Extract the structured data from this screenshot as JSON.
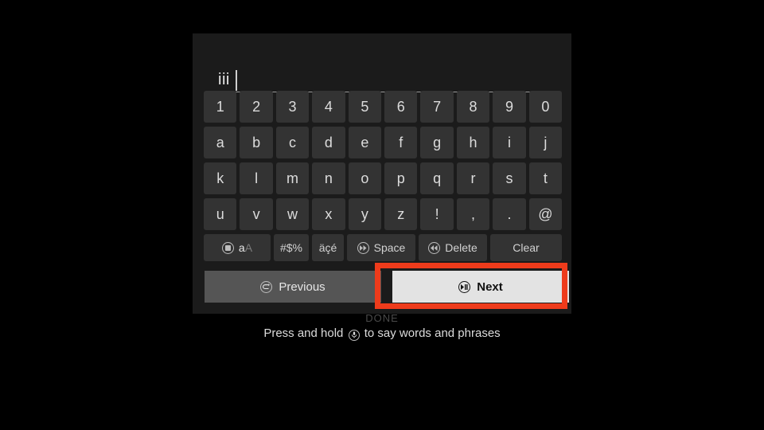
{
  "screen": {
    "background_color": "#000000",
    "panel_color": "#1b1b1b",
    "highlight_color": "#ee3b1b"
  },
  "input": {
    "value": "iii",
    "placeholder": ""
  },
  "keyboard": {
    "rows": [
      {
        "name": "numbers",
        "keys": [
          "1",
          "2",
          "3",
          "4",
          "5",
          "6",
          "7",
          "8",
          "9",
          "0"
        ]
      },
      {
        "name": "letters-1",
        "keys": [
          "a",
          "b",
          "c",
          "d",
          "e",
          "f",
          "g",
          "h",
          "i",
          "j"
        ]
      },
      {
        "name": "letters-2",
        "keys": [
          "k",
          "l",
          "m",
          "n",
          "o",
          "p",
          "q",
          "r",
          "s",
          "t"
        ]
      },
      {
        "name": "letters-3",
        "keys": [
          "u",
          "v",
          "w",
          "x",
          "y",
          "z",
          "!",
          ",",
          ".",
          "@"
        ]
      }
    ],
    "function_row": {
      "case_toggle": {
        "icon": "circle-square-icon",
        "lower": "a",
        "upper": "A"
      },
      "symbols": "#$%",
      "accents": "äçé",
      "space": {
        "icon": "circle-ff-icon",
        "label": "Space"
      },
      "delete": {
        "icon": "circle-rw-icon",
        "label": "Delete"
      },
      "clear": "Clear"
    }
  },
  "nav": {
    "previous": {
      "icon": "circle-back-icon",
      "label": "Previous",
      "focused": false
    },
    "next": {
      "icon": "circle-playpause-icon",
      "label": "Next",
      "focused": true
    }
  },
  "footer": {
    "done_label": "DONE",
    "hint_prefix": "Press and hold",
    "hint_icon": "microphone-icon",
    "hint_suffix": "to say words and phrases"
  }
}
